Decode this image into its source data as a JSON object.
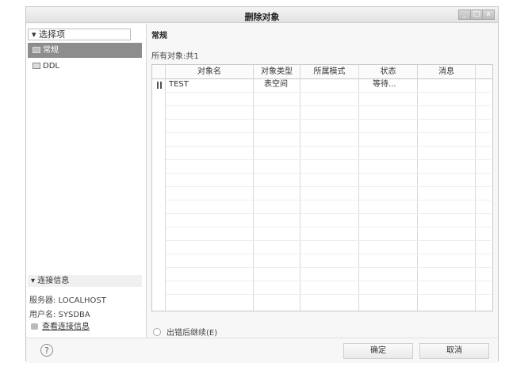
{
  "window": {
    "title": "删除对象",
    "controls": [
      "_",
      "□",
      "x"
    ]
  },
  "left": {
    "options_label": "选择项",
    "nav": [
      {
        "label": "常规",
        "selected": true
      },
      {
        "label": "DDL",
        "selected": false
      }
    ],
    "connection": {
      "heading": "连接信息",
      "server": "服务器: LOCALHOST",
      "user": "用户名: SYSDBA",
      "view_link": "查看连接信息"
    }
  },
  "main": {
    "section_title": "常规",
    "summary": "所有对象:共1",
    "table": {
      "columns": [
        "对象名",
        "对象类型",
        "所属模式",
        "状态",
        "消息"
      ],
      "rows": [
        {
          "name": "TEST",
          "type": "表空间",
          "schema": "",
          "status": "等待...",
          "message": ""
        }
      ]
    },
    "continue_on_error": "出错后继续(E)"
  },
  "footer": {
    "help": "?",
    "ok": "确定",
    "cancel": "取消"
  }
}
